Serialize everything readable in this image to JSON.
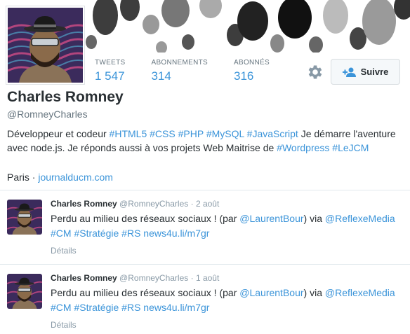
{
  "profile": {
    "name": "Charles Romney",
    "handle": "@RomneyCharles",
    "stats": [
      {
        "label": "TWEETS",
        "value": "1 547"
      },
      {
        "label": "ABONNEMENTS",
        "value": "314"
      },
      {
        "label": "ABONNÉS",
        "value": "316"
      }
    ],
    "follow_label": "Suivre",
    "bio": {
      "intro": "Développeur et codeur",
      "tags": [
        "#HTML5",
        "#CSS",
        "#PHP",
        "#MySQL",
        "#JavaScript"
      ],
      "mid": "Je démarre l'aventure avec node.js. Je réponds aussi à vos projets Web Maitrise de",
      "tag_wordpress": "#Wordpress",
      "tag_lejcm": "#LeJCM"
    },
    "location": "Paris",
    "separator": "·",
    "website": "journalducm.com"
  },
  "tweets": [
    {
      "name": "Charles Romney",
      "handle": "@RomneyCharles",
      "sep": "·",
      "date": "2 août",
      "text_start": "Perdu au milieu des réseaux sociaux ! (par",
      "mention1": "@LaurentBour",
      "text_mid": ") via",
      "mention2": "@ReflexeMedia",
      "tag1": "#CM",
      "tag2": "#Stratégie",
      "tag3": "#RS",
      "link": "news4u.li/m7gr",
      "details": "Détails"
    },
    {
      "name": "Charles Romney",
      "handle": "@RomneyCharles",
      "sep": "·",
      "date": "1 août",
      "text_start": "Perdu au milieu des réseaux sociaux ! (par",
      "mention1": "@LaurentBour",
      "text_mid": ") via",
      "mention2": "@ReflexeMedia",
      "tag1": "#CM",
      "tag2": "#Stratégie",
      "tag3": "#RS",
      "link": "news4u.li/m7gr",
      "details": "Détails"
    }
  ],
  "colors": {
    "link": "#3b94d9",
    "text": "#292f33",
    "muted": "#66757f"
  },
  "icons": {
    "settings": "gear-icon",
    "follow": "add-user-icon"
  }
}
